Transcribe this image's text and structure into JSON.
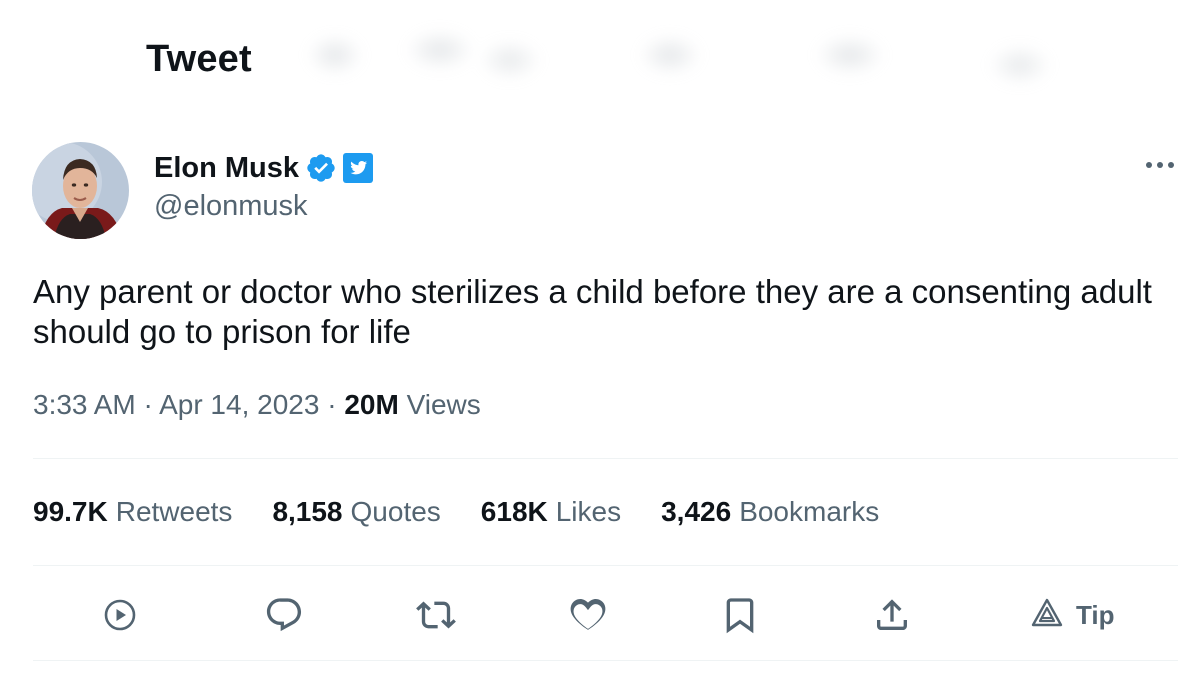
{
  "header": {
    "title": "Tweet"
  },
  "author": {
    "name": "Elon Musk",
    "handle": "@elonmusk",
    "verified_color": "#1d9bf0",
    "affiliate_badge": "twitter-bird-badge"
  },
  "tweet": {
    "text": "Any parent or doctor who sterilizes a child before they are a consenting adult should go to prison for life",
    "time": "3:33 AM",
    "date": "Apr 14, 2023",
    "sep": "·",
    "views_count": "20M",
    "views_label": "Views"
  },
  "stats": [
    {
      "count": "99.7K",
      "label": "Retweets"
    },
    {
      "count": "8,158",
      "label": "Quotes"
    },
    {
      "count": "618K",
      "label": "Likes"
    },
    {
      "count": "3,426",
      "label": "Bookmarks"
    }
  ],
  "actions": {
    "tip_label": "Tip",
    "icons": [
      "play-icon",
      "reply-icon",
      "retweet-icon",
      "like-icon",
      "bookmark-icon",
      "share-icon",
      "tip-icon"
    ]
  },
  "colors": {
    "text": "#0f1419",
    "secondary": "#536471",
    "accent": "#1d9bf0",
    "divider": "#eff3f4"
  }
}
